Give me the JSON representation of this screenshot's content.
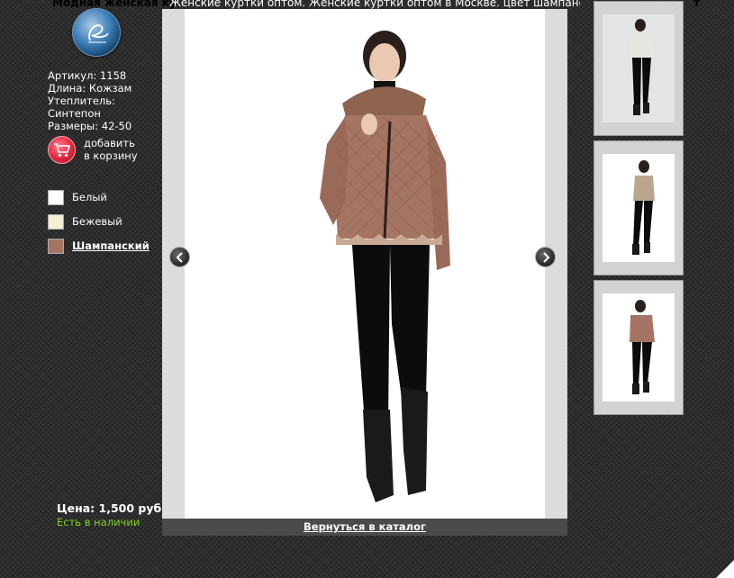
{
  "page": {
    "top_title_left": "Модная женская ку",
    "top_title_right": "т"
  },
  "viewer": {
    "caption": "Женские куртки оптом. Женские куртки оптом в Москве. цвет шампанский  ик (ж",
    "back_link": "Вернуться в каталог",
    "prev_icon": "chevron-left-icon",
    "next_icon": "chevron-right-icon"
  },
  "product": {
    "article": "Артикул: 1158",
    "length": "Длина: Кожзам",
    "insulation_label": "Утеплитель:",
    "insulation_value": "Синтепон",
    "sizes": "Размеры: 42-50",
    "add_to_cart_line1": "добавить",
    "add_to_cart_line2": "в корзину",
    "price": "Цена: 1,500 руб.",
    "stock": "Есть в наличии"
  },
  "colors": [
    {
      "label": "Белый",
      "swatch": "#ffffff",
      "selected": false
    },
    {
      "label": "Бежевый",
      "swatch": "#f3f0d4",
      "selected": false
    },
    {
      "label": "Шампанский",
      "swatch": "#a57563",
      "selected": true
    }
  ],
  "theme": {
    "background": "#333333",
    "stock_color": "#7dd321",
    "jacket_champagne": "#a57563",
    "jacket_white": "#e8e6e0",
    "jacket_beige": "#b9a68c"
  },
  "thumbnails": [
    {
      "jacket": "white"
    },
    {
      "jacket": "beige"
    },
    {
      "jacket": "champagne"
    }
  ]
}
